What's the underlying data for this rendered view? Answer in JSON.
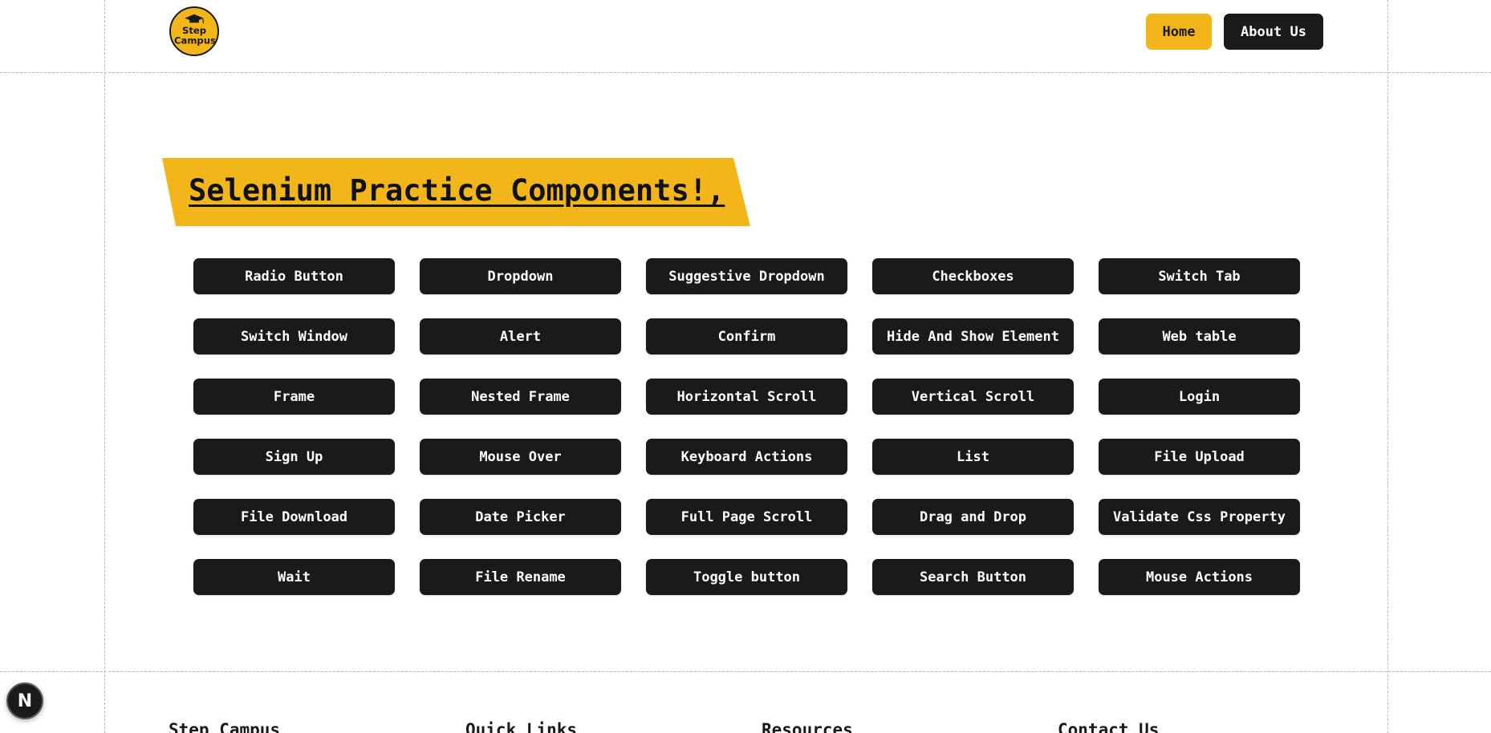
{
  "header": {
    "logo_text": [
      "Step",
      "Campus"
    ],
    "nav": {
      "home_label": "Home",
      "about_label": "About Us"
    }
  },
  "main": {
    "title": "Selenium Practice Components!,",
    "components": [
      "Radio Button",
      "Dropdown",
      "Suggestive Dropdown",
      "Checkboxes",
      "Switch Tab",
      "Switch Window",
      "Alert",
      "Confirm",
      "Hide And Show Element",
      "Web table",
      "Frame",
      "Nested Frame",
      "Horizontal Scroll",
      "Vertical Scroll",
      "Login",
      "Sign Up",
      "Mouse Over",
      "Keyboard Actions",
      "List",
      "File Upload",
      "File Download",
      "Date Picker",
      "Full Page Scroll",
      "Drag and Drop",
      "Validate Css Property",
      "Wait",
      "File Rename",
      "Toggle button",
      "Search Button",
      "Mouse Actions"
    ]
  },
  "footer": {
    "columns": [
      "Step Campus",
      "Quick Links",
      "Resources",
      "Contact Us"
    ]
  },
  "dev_badge": {
    "label": "N"
  },
  "colors": {
    "accent": "#f2b51a",
    "dark": "#1a1a1a",
    "background": "#ffffff"
  }
}
